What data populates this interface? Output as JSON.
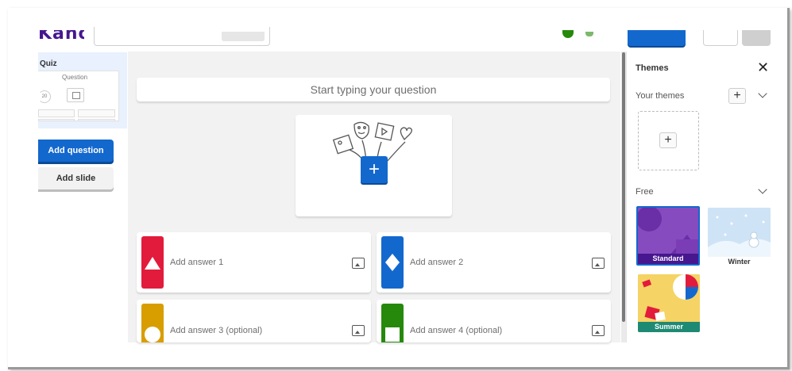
{
  "header": {
    "logo_text": "Kahoot!",
    "brand_color": "#46178f",
    "accent_color": "#1368ce"
  },
  "sidebar": {
    "slide_type": "Quiz",
    "thumb_question": "Question",
    "thumb_timer": "20",
    "add_question_label": "Add question",
    "add_slide_label": "Add slide"
  },
  "editor": {
    "question_placeholder": "Start typing your question",
    "answers": [
      {
        "label": "Add answer 1",
        "shape": "triangle-icon",
        "color": "#e21b3c"
      },
      {
        "label": "Add answer 2",
        "shape": "diamond-icon",
        "color": "#1368ce"
      },
      {
        "label": "Add answer 3 (optional)",
        "shape": "circle-icon",
        "color": "#d89e00"
      },
      {
        "label": "Add answer 4 (optional)",
        "shape": "square-icon",
        "color": "#26890c"
      }
    ]
  },
  "themes_panel": {
    "title": "Themes",
    "your_themes_label": "Your themes",
    "free_label": "Free",
    "themes": [
      {
        "name": "Standard",
        "caption_color": "#46178f",
        "selected": true
      },
      {
        "name": "Winter",
        "caption_color": "#ffffff"
      },
      {
        "name": "Summer",
        "caption_color": "#1e8a73"
      }
    ]
  }
}
